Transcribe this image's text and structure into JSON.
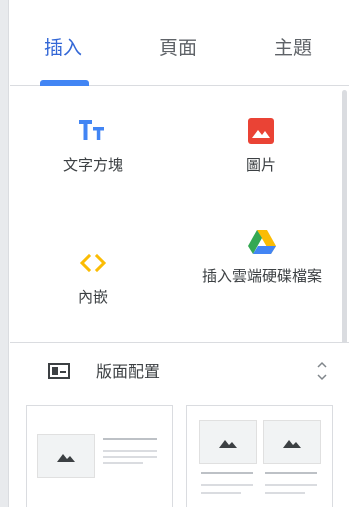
{
  "tabs": [
    {
      "label": "插入",
      "active": true
    },
    {
      "label": "頁面",
      "active": false
    },
    {
      "label": "主題",
      "active": false
    }
  ],
  "insert_items": {
    "text_box": {
      "label": "文字方塊",
      "icon": "text-box-icon"
    },
    "image": {
      "label": "圖片",
      "icon": "image-icon"
    },
    "embed": {
      "label": "內嵌",
      "icon": "embed-code-icon"
    },
    "drive": {
      "label": "插入雲端硬碟檔案",
      "icon": "google-drive-icon"
    }
  },
  "layouts": {
    "title": "版面配置",
    "icon": "layout-icon",
    "collapse_icon": "chevron-collapse-icon"
  },
  "colors": {
    "accent_blue": "#4285f4",
    "tab_active_text": "#3367d6",
    "image_red": "#ea4335",
    "embed_yellow": "#fbbc04",
    "drive_green": "#34a853"
  }
}
